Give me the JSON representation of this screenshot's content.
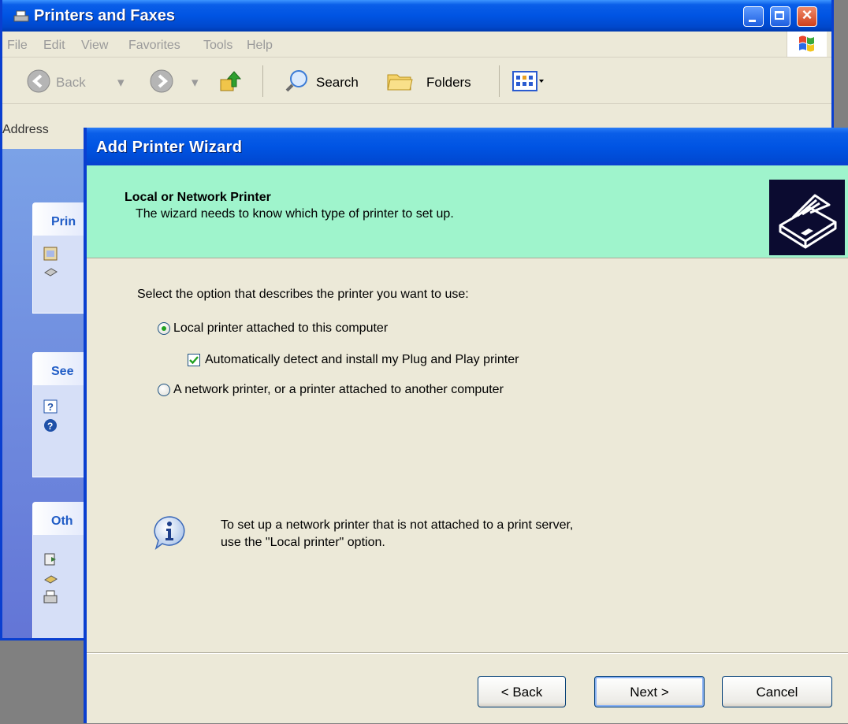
{
  "bg_window": {
    "title": "Printers and Faxes",
    "menu": [
      "File",
      "Edit",
      "View",
      "Favorites",
      "Tools",
      "Help"
    ],
    "toolbar": {
      "back": "Back",
      "search": "Search",
      "folders": "Folders"
    },
    "address_label": "Address",
    "panels": [
      "Prin",
      "See",
      "Oth"
    ]
  },
  "wizard": {
    "title": "Add Printer Wizard",
    "header_title": "Local or Network Printer",
    "header_subtitle": "The wizard needs to know which type of printer to set up.",
    "prompt": "Select the option that describes the printer you want to use:",
    "option_local": "Local printer attached to this computer",
    "auto_detect": "Automatically detect and install my Plug and Play printer",
    "option_network": "A network printer, or a printer attached to another computer",
    "info_line1": "To set up a network printer that is not attached to a print server,",
    "info_line2": "use the \"Local printer\" option.",
    "selected_option": "local",
    "auto_detect_checked": true,
    "buttons": {
      "back": "< Back",
      "next": "Next >",
      "cancel": "Cancel"
    }
  },
  "colors": {
    "title_blue": "#0054e3",
    "header_green": "#9ff4cc",
    "dialog_bg": "#ece9d8"
  }
}
